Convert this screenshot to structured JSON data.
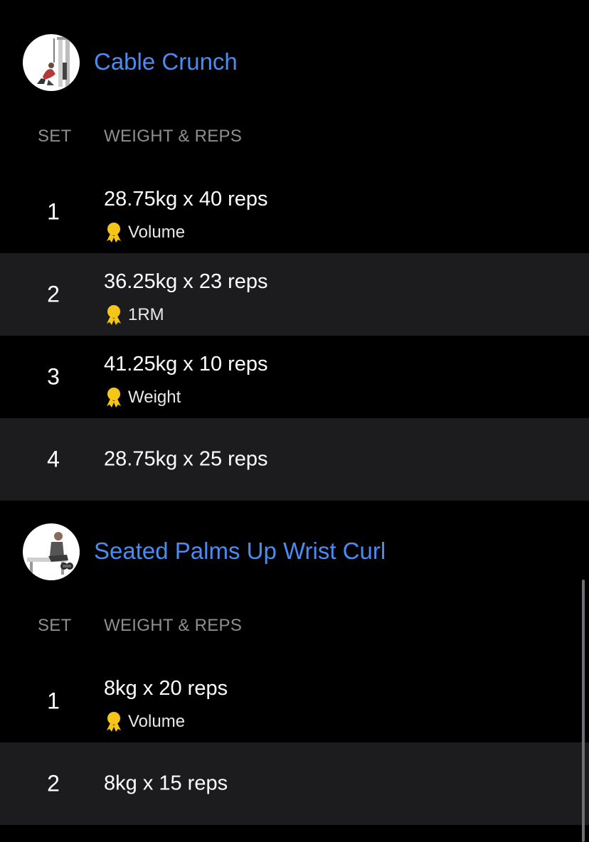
{
  "exercises": [
    {
      "title": "Cable Crunch",
      "image_icon": "cable-crunch-illustration",
      "col_set": "SET",
      "col_weight_reps": "WEIGHT & REPS",
      "sets": [
        {
          "num": "1",
          "text": "28.75kg x 40 reps",
          "pr": "Volume"
        },
        {
          "num": "2",
          "text": "36.25kg x 23 reps",
          "pr": "1RM"
        },
        {
          "num": "3",
          "text": "41.25kg x 10 reps",
          "pr": "Weight"
        },
        {
          "num": "4",
          "text": "28.75kg x 25 reps",
          "pr": null
        }
      ]
    },
    {
      "title": "Seated Palms Up Wrist Curl",
      "image_icon": "wrist-curl-illustration",
      "col_set": "SET",
      "col_weight_reps": "WEIGHT & REPS",
      "sets": [
        {
          "num": "1",
          "text": "8kg x 20 reps",
          "pr": "Volume"
        },
        {
          "num": "2",
          "text": "8kg x 15 reps",
          "pr": null
        }
      ]
    }
  ],
  "colors": {
    "background": "#000000",
    "row_alt": "#1c1c1e",
    "title_accent": "#4a8cf0",
    "header_text": "#8e8e93",
    "medal": "#f5c518"
  }
}
